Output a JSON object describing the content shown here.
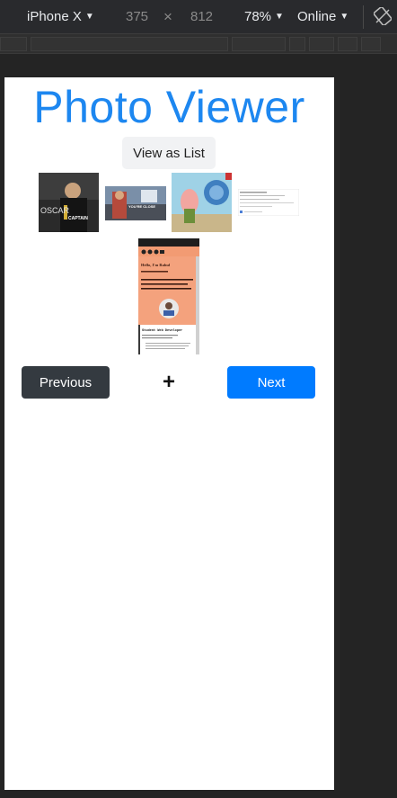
{
  "devtools": {
    "device": "iPhone X",
    "width": "375",
    "times": "×",
    "height": "812",
    "zoom": "78%",
    "network": "Online"
  },
  "page": {
    "title": "Photo Viewer",
    "view_toggle_label": "View as List",
    "thumbnails": [
      {
        "label": "OSCAR",
        "caption": "CAPTAIN"
      },
      {
        "caption": "YOU'RE CLOSE"
      },
      {
        "label": "spongebob meme"
      },
      {
        "label": "document screenshot"
      },
      {
        "heading": "Hello, I'm Rahul",
        "line1": "I am a graduate student, web developer, and aspiring data scientist!",
        "section": "Student Web Developer"
      }
    ],
    "prev_label": "Previous",
    "plus_label": "+",
    "next_label": "Next"
  },
  "colors": {
    "accent": "#1d87f0",
    "next": "#007bff",
    "prev": "#343a40"
  }
}
